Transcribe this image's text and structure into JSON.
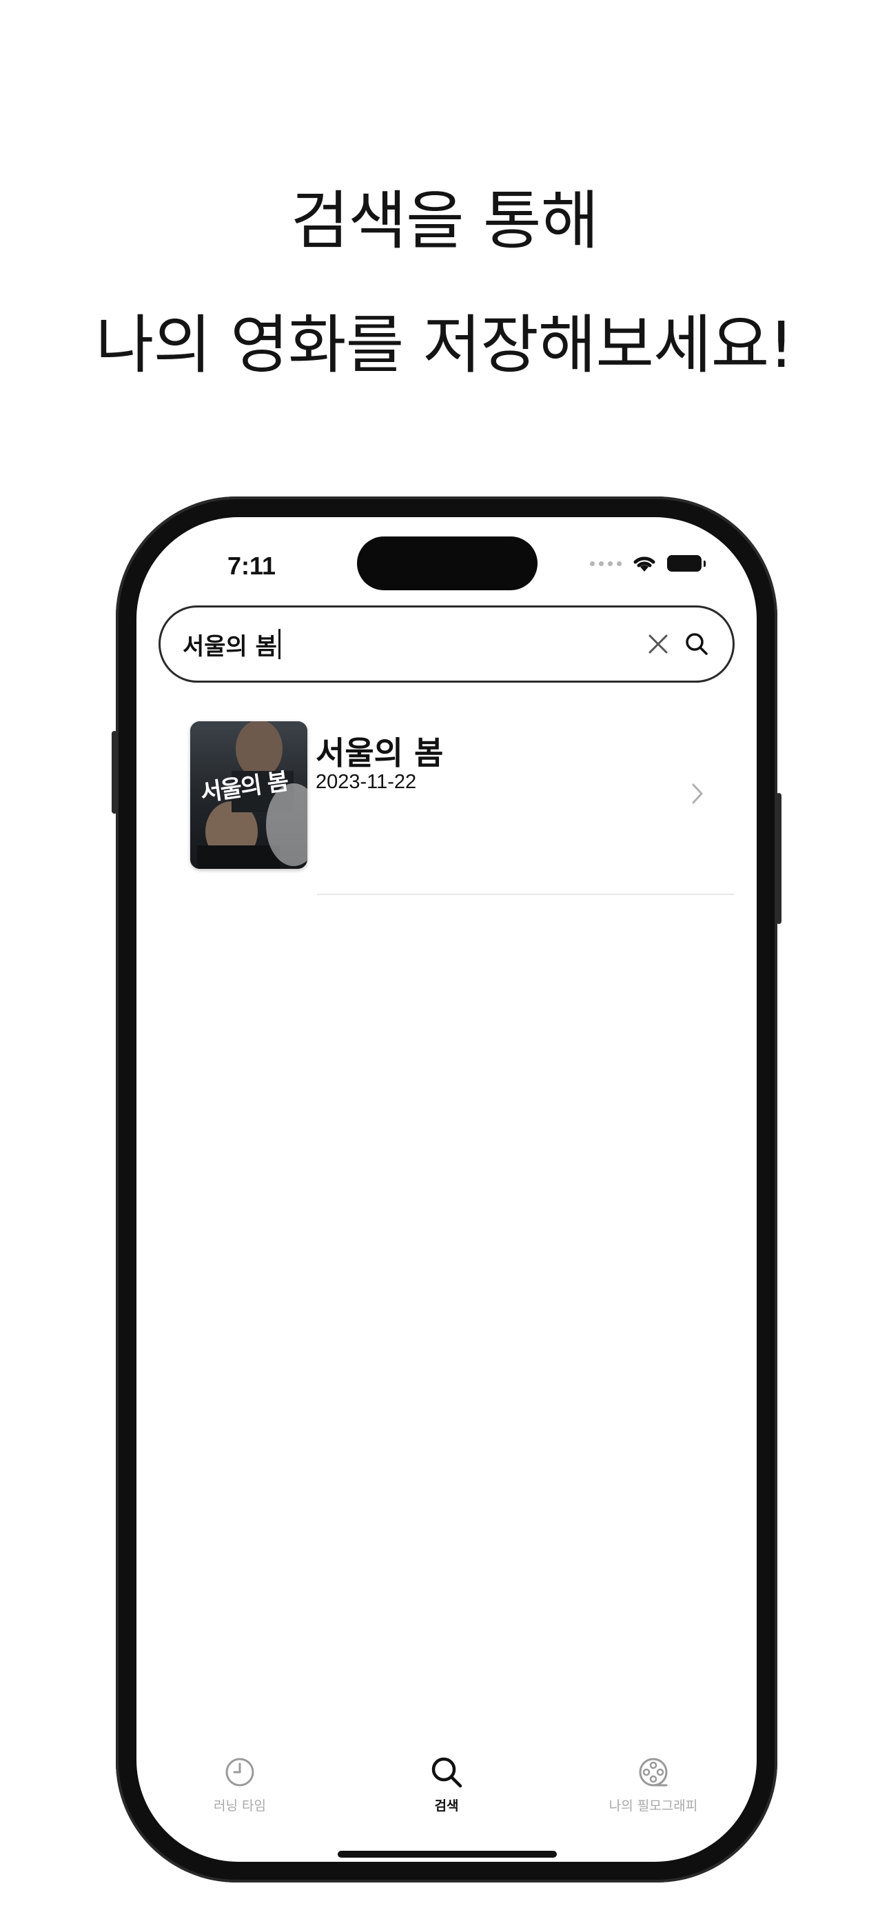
{
  "headline": {
    "line1": "검색을 통해",
    "line2": "나의 영화를 저장해보세요!"
  },
  "status_bar": {
    "time": "7:11"
  },
  "search": {
    "query": "서울의 봄",
    "clear_icon": "close-icon",
    "search_icon": "magnifier-icon"
  },
  "results": [
    {
      "title": "서울의 봄",
      "release_date": "2023-11-22",
      "poster_text": "서울의 봄"
    }
  ],
  "tabbar": {
    "tabs": [
      {
        "label": "러닝 타임",
        "icon": "clock-icon",
        "active": false
      },
      {
        "label": "검색",
        "icon": "search-icon",
        "active": true
      },
      {
        "label": "나의 필모그래피",
        "icon": "film-reel-icon",
        "active": false
      }
    ]
  },
  "colors": {
    "text": "#111111",
    "inactive_tab": "#a8a8a8",
    "divider": "#e8e8e8",
    "frame": "#0f0f0f"
  }
}
